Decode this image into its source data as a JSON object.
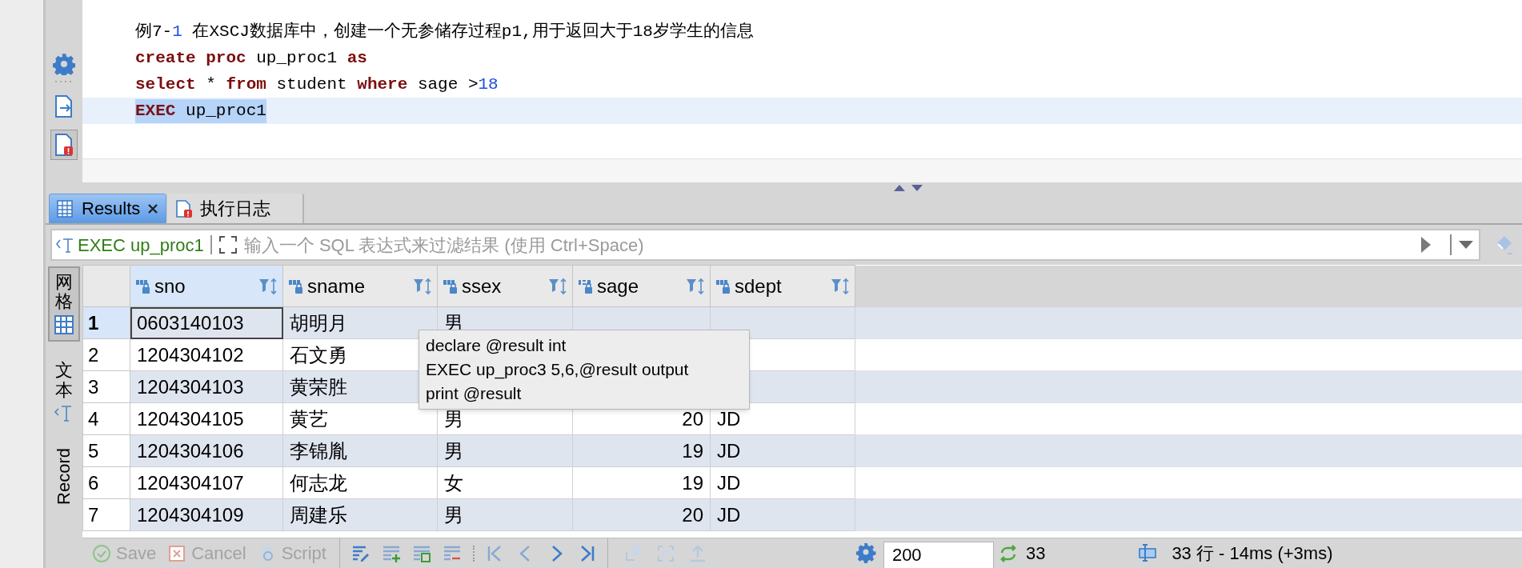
{
  "editor": {
    "lines": [
      {
        "current": false,
        "selected": false,
        "tokens": [
          {
            "kind": "text",
            "text": "例7-"
          },
          {
            "kind": "number",
            "text": "1"
          },
          {
            "kind": "text",
            "text": " 在XSCJ数据库中，创建一个无参储存过程p1,用于返回大于18岁学生的信息"
          }
        ]
      },
      {
        "current": false,
        "selected": false,
        "tokens": [
          {
            "kind": "keyword",
            "text": "create proc"
          },
          {
            "kind": "text",
            "text": " up_proc1 "
          },
          {
            "kind": "keyword",
            "text": "as"
          }
        ]
      },
      {
        "current": false,
        "selected": false,
        "tokens": [
          {
            "kind": "keyword",
            "text": "select"
          },
          {
            "kind": "text",
            "text": " * "
          },
          {
            "kind": "keyword",
            "text": "from"
          },
          {
            "kind": "text",
            "text": " student "
          },
          {
            "kind": "keyword",
            "text": "where"
          },
          {
            "kind": "text",
            "text": " sage >"
          },
          {
            "kind": "number",
            "text": "18"
          }
        ]
      },
      {
        "current": true,
        "selected": true,
        "tokens": [
          {
            "kind": "keyword",
            "text": "EXEC"
          },
          {
            "kind": "text",
            "text": " up_proc1"
          }
        ]
      }
    ]
  },
  "tabs": [
    {
      "label": "Results",
      "kind": "results",
      "selected": true,
      "closable": true
    },
    {
      "label": "执行日志",
      "kind": "log",
      "selected": false,
      "closable": false
    }
  ],
  "filter": {
    "query": "EXEC up_proc1",
    "placeholder": "输入一个 SQL 表达式来过滤结果 (使用 Ctrl+Space)"
  },
  "view_tabs": [
    {
      "label": "网格",
      "kind": "grid",
      "selected": true
    },
    {
      "label": "文本",
      "kind": "text",
      "selected": false
    },
    {
      "label": "Record",
      "kind": "record",
      "selected": false
    }
  ],
  "table": {
    "columns": [
      {
        "name": "sno",
        "kind": "string",
        "selected": true
      },
      {
        "name": "sname",
        "kind": "string",
        "selected": false
      },
      {
        "name": "ssex",
        "kind": "string",
        "selected": false
      },
      {
        "name": "sage",
        "kind": "number",
        "selected": false
      },
      {
        "name": "sdept",
        "kind": "string",
        "selected": false
      }
    ],
    "rows": [
      {
        "number": "1",
        "selected": true,
        "cells": [
          "0603140103",
          "胡明月",
          "男",
          null,
          null
        ]
      },
      {
        "number": "2",
        "selected": false,
        "cells": [
          "1204304102",
          "石文勇",
          null,
          null,
          null
        ]
      },
      {
        "number": "3",
        "selected": false,
        "cells": [
          "1204304103",
          "黄荣胜",
          null,
          null,
          null
        ]
      },
      {
        "number": "4",
        "selected": false,
        "cells": [
          "1204304105",
          "黄艺",
          "男",
          "20",
          "JD"
        ]
      },
      {
        "number": "5",
        "selected": false,
        "cells": [
          "1204304106",
          "李锦胤",
          "男",
          "19",
          "JD"
        ]
      },
      {
        "number": "6",
        "selected": false,
        "cells": [
          "1204304107",
          "何志龙",
          "女",
          "19",
          "JD"
        ]
      },
      {
        "number": "7",
        "selected": false,
        "cells": [
          "1204304109",
          "周建乐",
          "男",
          "20",
          "JD"
        ]
      }
    ]
  },
  "tooltip": {
    "lines": [
      "declare @result int",
      "EXEC up_proc3 5,6,@result output",
      "print @result"
    ]
  },
  "toolbar": {
    "buttons": [
      {
        "label": "Save",
        "kind": "save",
        "disabled": true
      },
      {
        "label": "Cancel",
        "kind": "cancel",
        "disabled": true
      },
      {
        "label": "Script",
        "kind": "script",
        "disabled": true
      }
    ],
    "fetch_size": "200",
    "row_count": "33",
    "status": "33 行 - 14ms (+3ms)"
  }
}
